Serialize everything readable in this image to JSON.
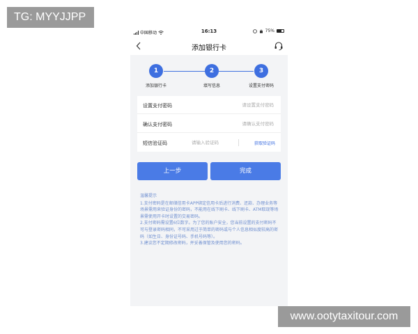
{
  "watermark": {
    "top_left": "TG: MYYJJPP",
    "bottom_right": "www.ootytaxitour.com"
  },
  "status_bar": {
    "carrier": "中国移动",
    "time": "16:13",
    "battery": "75%"
  },
  "nav": {
    "title": "添加银行卡",
    "back_icon": "chevron-left-icon",
    "service_icon": "headset-icon"
  },
  "steps": [
    {
      "number": "1",
      "label": "添加银行卡"
    },
    {
      "number": "2",
      "label": "填写信息"
    },
    {
      "number": "3",
      "label": "设置支付密码"
    }
  ],
  "form": {
    "pay_password": {
      "label": "设置支付密码",
      "placeholder": "请设置支付密码"
    },
    "confirm_password": {
      "label": "确认支付密码",
      "placeholder": "请确认支付密码"
    },
    "sms_code": {
      "label": "短信验证码",
      "placeholder": "请输入验证码",
      "button": "获取验证码"
    }
  },
  "buttons": {
    "prev": "上一步",
    "done": "完成"
  },
  "tips": {
    "title": "温馨提示",
    "items": [
      "1.支付密码是在邮储信用卡APP绑定信用卡后进行消费、还款、办理业务等场景需用来验证身份的密码，不能用在线下刷卡、线下刷卡、ATM取现等场景需使用开卡时设置的交易密码。",
      "2.支付密码需设置6位数字。为了您的账户安全，您当前设置的支付密码不可与登录密码相同，不可采用过于简单的密码或与个人信息相似度较高的密码（如生日、身份证号码、手机号码等）。",
      "3.建议您不定期修改密码，并妥善保管及使用您的密码。"
    ]
  },
  "colors": {
    "accent": "#3e6fe0",
    "button": "#4a7be6",
    "background": "#f3f4f6"
  }
}
